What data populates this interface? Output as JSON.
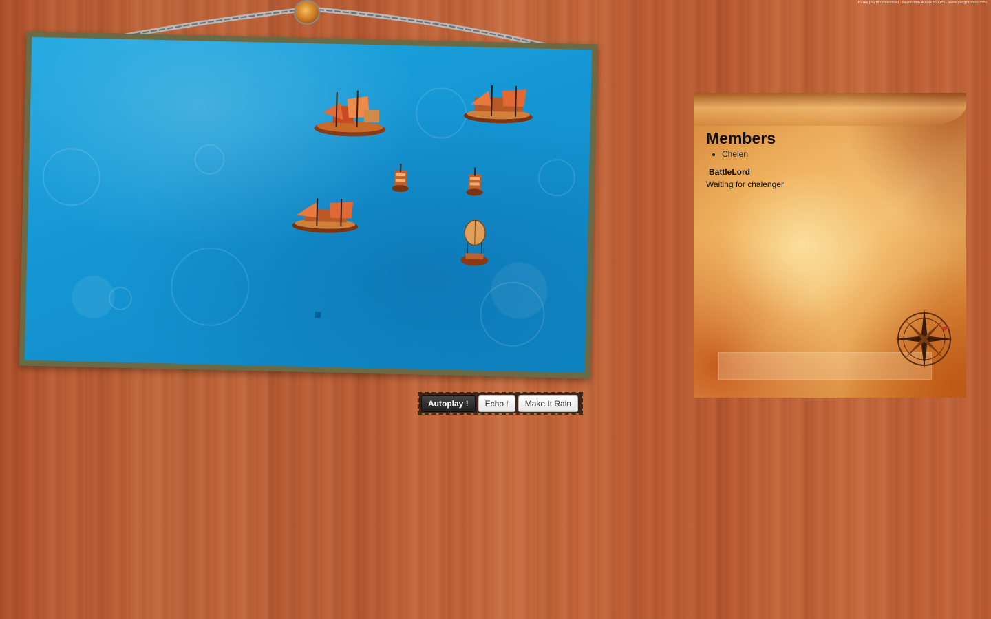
{
  "top_note": "Hi-res JPG file download  ·  Resolution 4000x3000px  ·  www.psdgraphics.com",
  "controls": {
    "autoplay_label": "Autoplay !",
    "echo_label": "Echo !",
    "rain_label": "Make It Rain"
  },
  "panel": {
    "title": "Members",
    "members": [
      "Chelen"
    ],
    "player_name": "BattleLord",
    "status": "Waiting for chalenger"
  },
  "colors": {
    "wood": "#bd5d33",
    "water": "#1596d3",
    "parchment": "#e9a95a",
    "frame": "#6b6a45"
  }
}
